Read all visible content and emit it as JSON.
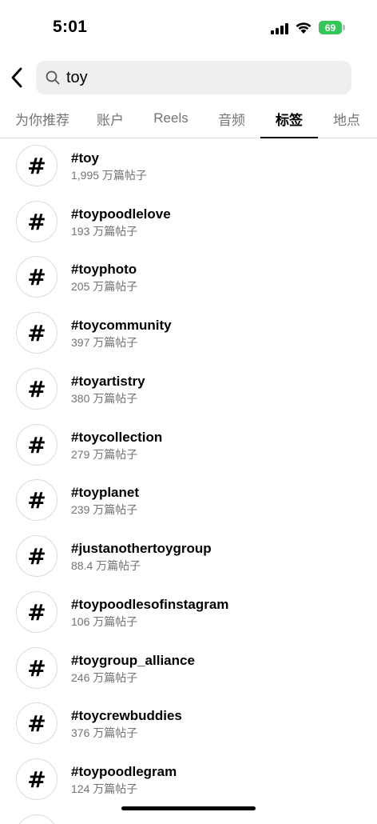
{
  "status_bar": {
    "time": "5:01",
    "battery": "69",
    "battery_color": "#34c759"
  },
  "header": {
    "back_icon": "chevron-left-icon",
    "search_icon": "search-icon",
    "search_value": "toy"
  },
  "tabs": [
    {
      "label": "为你推荐",
      "active": false
    },
    {
      "label": "账户",
      "active": false
    },
    {
      "label": "Reels",
      "active": false
    },
    {
      "label": "音频",
      "active": false
    },
    {
      "label": "标签",
      "active": true
    },
    {
      "label": "地点",
      "active": false
    }
  ],
  "results": [
    {
      "icon": "#",
      "name": "#toy",
      "count": "1,995 万篇帖子"
    },
    {
      "icon": "#",
      "name": "#toypoodlelove",
      "count": "193 万篇帖子"
    },
    {
      "icon": "#",
      "name": "#toyphoto",
      "count": "205 万篇帖子"
    },
    {
      "icon": "#",
      "name": "#toycommunity",
      "count": "397 万篇帖子"
    },
    {
      "icon": "#",
      "name": "#toyartistry",
      "count": "380 万篇帖子"
    },
    {
      "icon": "#",
      "name": "#toycollection",
      "count": "279 万篇帖子"
    },
    {
      "icon": "#",
      "name": "#toyplanet",
      "count": "239 万篇帖子"
    },
    {
      "icon": "#",
      "name": "#justanothertoygroup",
      "count": "88.4 万篇帖子"
    },
    {
      "icon": "#",
      "name": "#toypoodlesofinstagram",
      "count": "106 万篇帖子"
    },
    {
      "icon": "#",
      "name": "#toygroup_alliance",
      "count": "246 万篇帖子"
    },
    {
      "icon": "#",
      "name": "#toycrewbuddies",
      "count": "376 万篇帖子"
    },
    {
      "icon": "#",
      "name": "#toypoodlegram",
      "count": "124 万篇帖子"
    }
  ]
}
